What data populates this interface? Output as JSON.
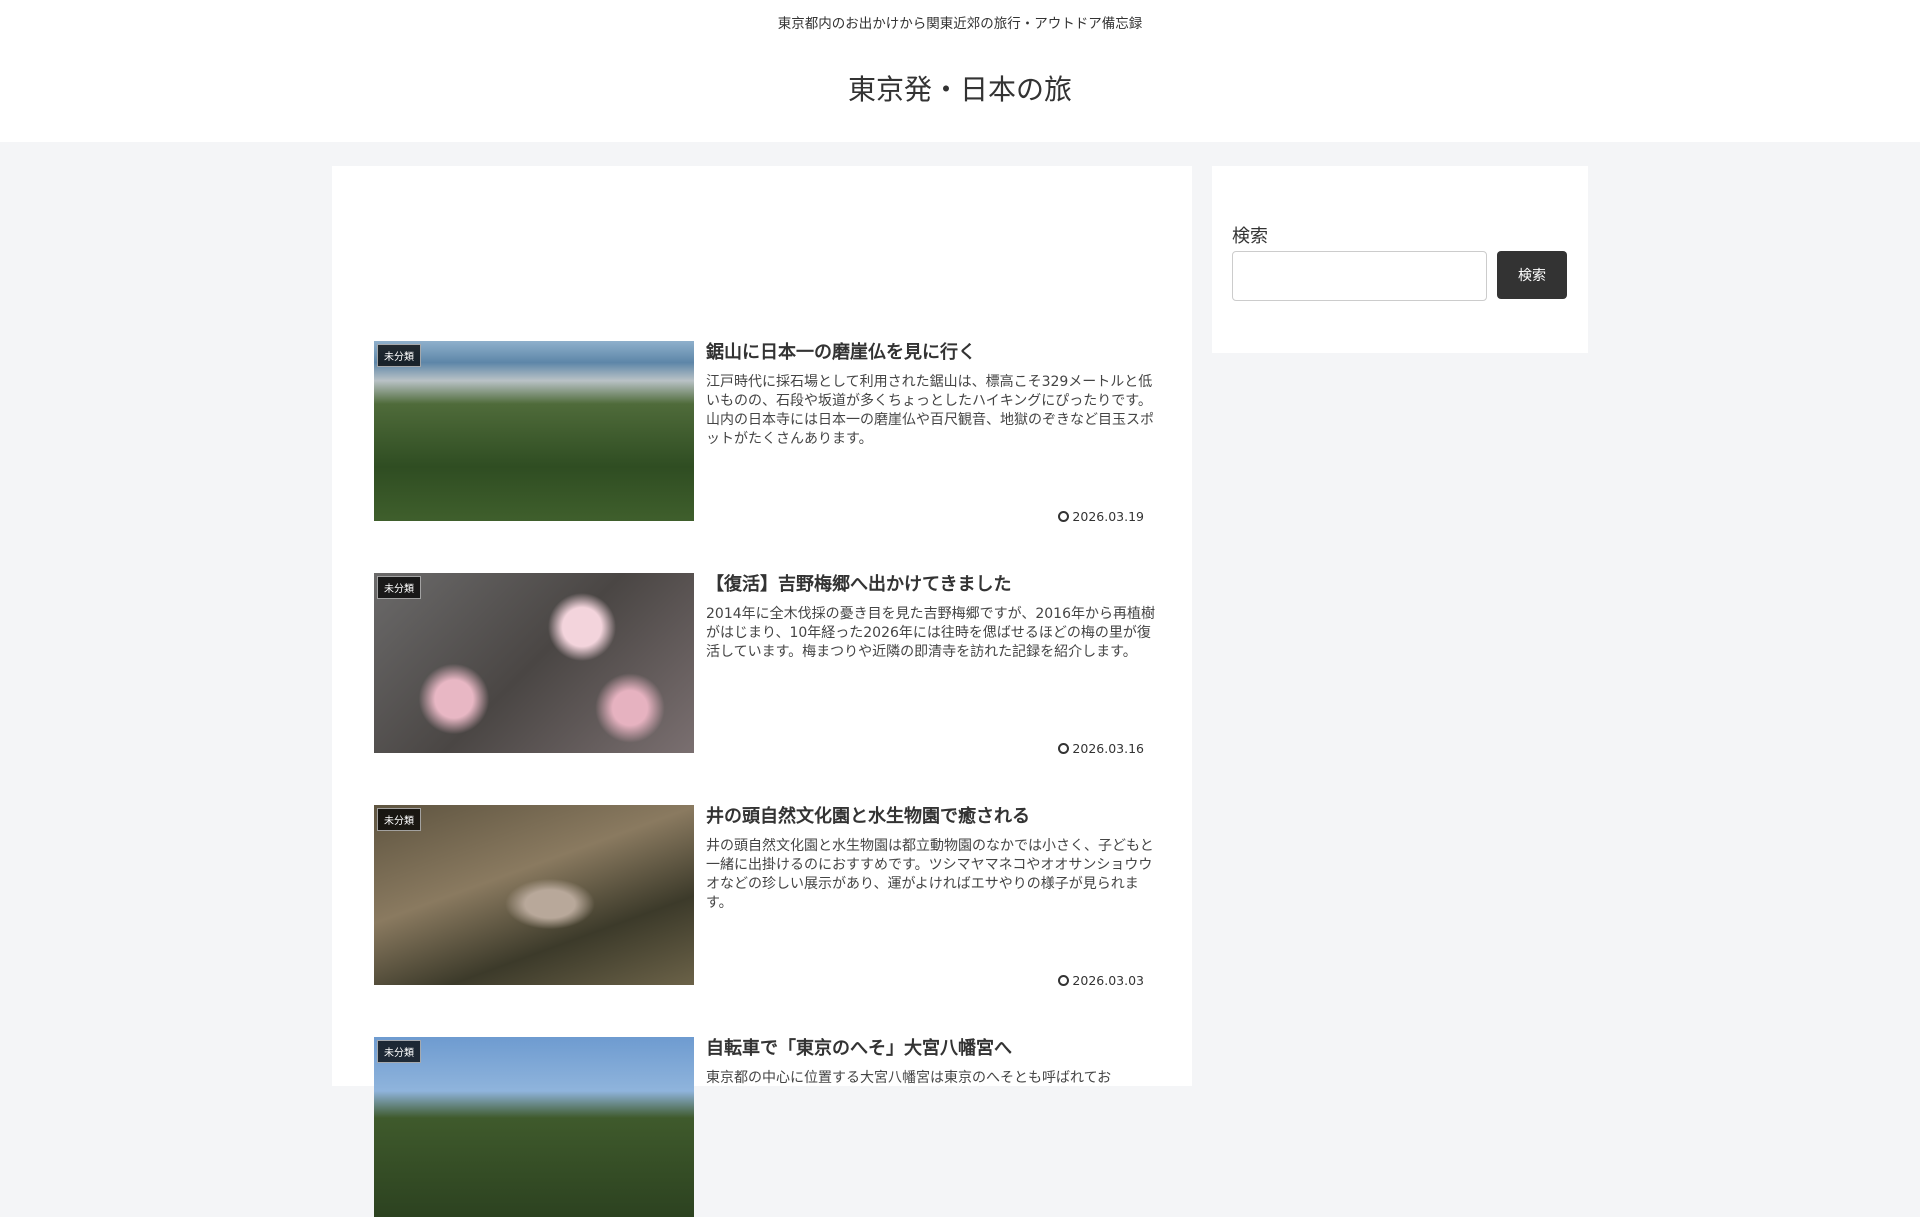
{
  "header": {
    "tagline": "東京都内のお出かけから関東近郊の旅行・アウトドア備忘録",
    "site_title": "東京発・日本の旅"
  },
  "entries": [
    {
      "category": "未分類",
      "title": "鋸山に日本一の磨崖仏を見に行く",
      "snippet": "江戸時代に採石場として利用された鋸山は、標高こそ329メートルと低いものの、石段や坂道が多くちょっとしたハイキングにぴったりです。山内の日本寺には日本一の磨崖仏や百尺観音、地獄のぞきなど目玉スポットがたくさんあります。",
      "date": "2026.03.19"
    },
    {
      "category": "未分類",
      "title": "【復活】吉野梅郷へ出かけてきました",
      "snippet": "2014年に全木伐採の憂き目を見た吉野梅郷ですが、2016年から再植樹がはじまり、10年経った2026年には往時を偲ばせるほどの梅の里が復活しています。梅まつりや近隣の即清寺を訪れた記録を紹介します。",
      "date": "2026.03.16"
    },
    {
      "category": "未分類",
      "title": "井の頭自然文化園と水生物園で癒される",
      "snippet": "井の頭自然文化園と水生物園は都立動物園のなかでは小さく、子どもと一緒に出掛けるのにおすすめです。ツシマヤマネコやオオサンショウウオなどの珍しい展示があり、運がよければエサやりの様子が見られます。",
      "date": "2026.03.03"
    },
    {
      "category": "未分類",
      "title": "自転車で「東京のへそ」大宮八幡宮へ",
      "snippet": "東京都の中心に位置する大宮八幡宮は東京のへそとも呼ばれてお",
      "date": ""
    }
  ],
  "sidebar": {
    "search_label": "検索",
    "search_button": "検索",
    "search_value": ""
  }
}
